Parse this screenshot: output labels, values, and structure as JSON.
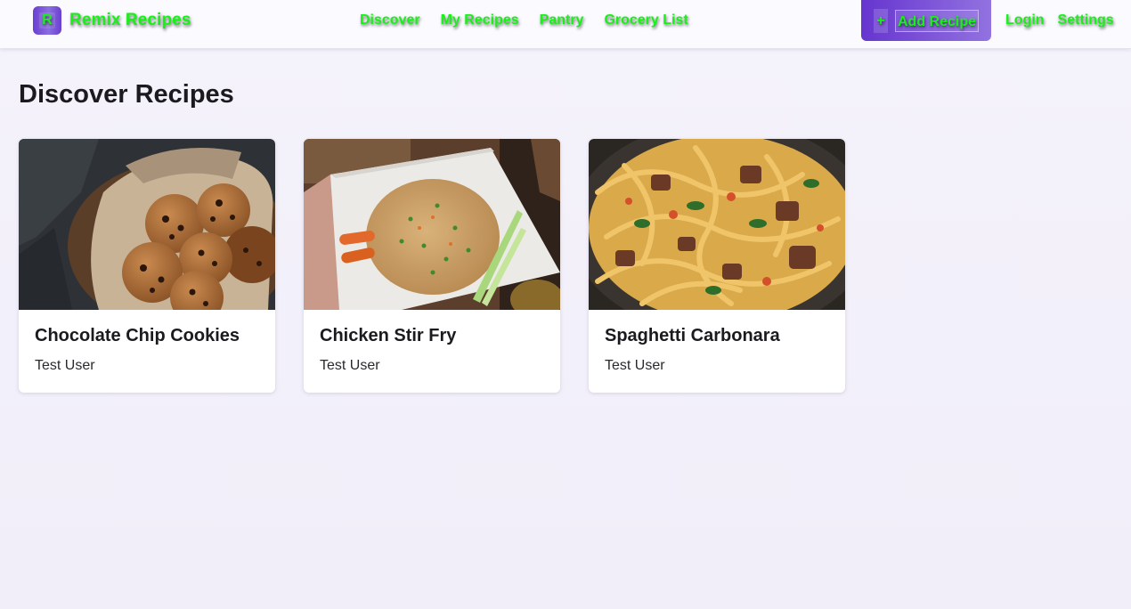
{
  "header": {
    "logo_letter": "R",
    "brand": "Remix Recipes",
    "nav": [
      {
        "label": "Discover"
      },
      {
        "label": "My Recipes"
      },
      {
        "label": "Pantry"
      },
      {
        "label": "Grocery List"
      }
    ],
    "add_button": {
      "icon": "+",
      "label": "Add Recipe"
    },
    "right_links": [
      {
        "label": "Login"
      },
      {
        "label": "Settings"
      }
    ]
  },
  "main": {
    "title": "Discover Recipes",
    "recipes": [
      {
        "title": "Chocolate Chip Cookies",
        "author": "Test User",
        "image": "cookies-photo"
      },
      {
        "title": "Chicken Stir Fry",
        "author": "Test User",
        "image": "fried-rice-photo"
      },
      {
        "title": "Spaghetti Carbonara",
        "author": "Test User",
        "image": "pasta-photo"
      }
    ]
  },
  "colors": {
    "accent": "#6635cf",
    "nav_text": "#19f019",
    "background": "#f3f1fa"
  }
}
